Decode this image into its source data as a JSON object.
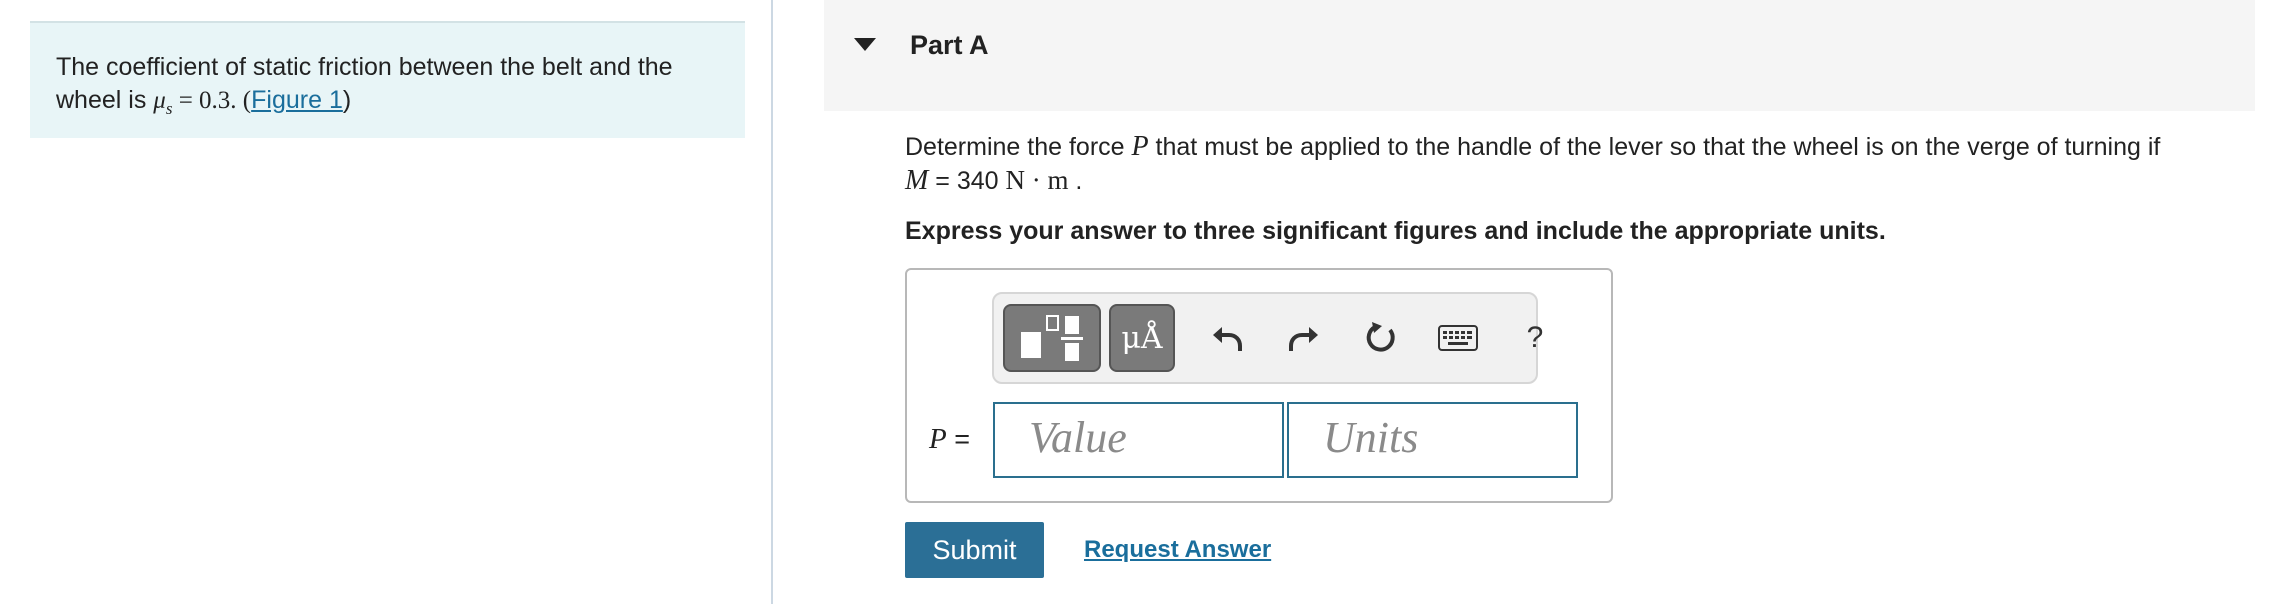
{
  "info": {
    "text_before": "The coefficient of static friction between the belt and the wheel is ",
    "mu_symbol": "μ",
    "mu_sub": "s",
    "equals_value": " = 0.3. (",
    "figure_link": "Figure 1",
    "close_paren": ")"
  },
  "part": {
    "title": "Part A"
  },
  "question": {
    "line1_before": "Determine the force ",
    "force_var": "P",
    "line1_after": " that must be applied to the handle of the lever so that the wheel is on the verge of turning if",
    "moment_var": "M",
    "moment_value": " = 340 ",
    "moment_units": "N · m",
    "end": " ."
  },
  "instruction": "Express your answer to three significant figures and include the appropriate units.",
  "toolbar": {
    "mu_label": "μÅ",
    "help_label": "?"
  },
  "answer": {
    "label_var": "P",
    "label_eq": " =",
    "value_placeholder": "Value",
    "units_placeholder": "Units"
  },
  "actions": {
    "submit_label": "Submit",
    "request_label": "Request Answer"
  }
}
